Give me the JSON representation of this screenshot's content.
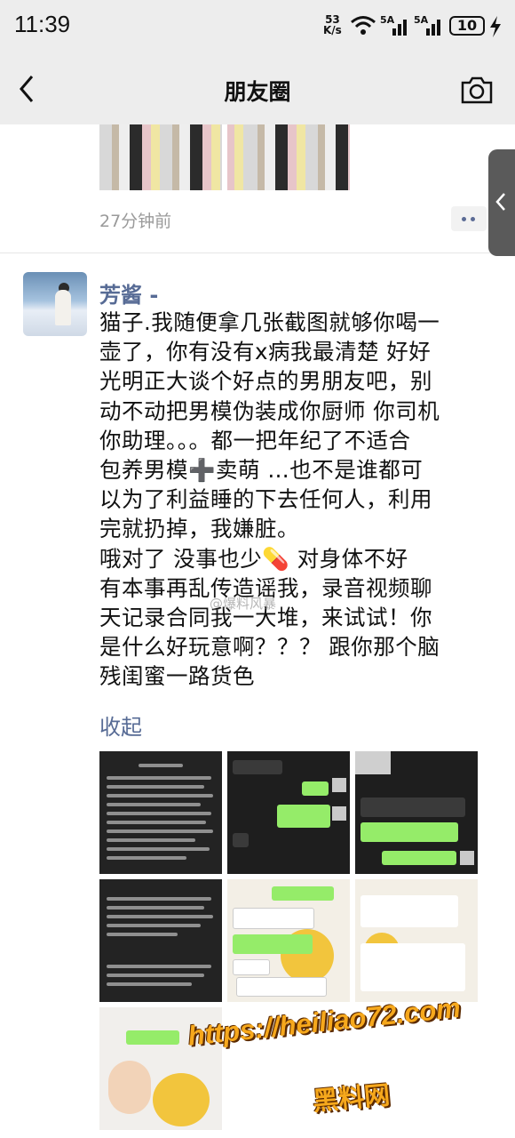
{
  "status_bar": {
    "time": "11:39",
    "net_speed_value": "53",
    "net_speed_unit": "K/s",
    "signal_1_label": "5A",
    "signal_2_label": "5A",
    "battery": "10"
  },
  "nav": {
    "title": "朋友圈",
    "back_icon": "chevron-left-icon",
    "camera_icon": "camera-icon"
  },
  "prev_post": {
    "timestamp": "27分钟前"
  },
  "post": {
    "username": "芳酱 -",
    "text": "猫子.我随便拿几张截图就够你喝一\n壶了，你有没有x病我最清楚 好好\n光明正大谈个好点的男朋友吧，别\n动不动把男模伪装成你厨师 你司机\n你助理。。。都一把年纪了不适合\n包养男模➕卖萌 …也不是谁都可\n以为了利益睡的下去任何人，利用\n完就扔掉，我嫌脏。\n哦对了 没事也少💊 对身体不好\n有本事再乱传造谣我，录音视频聊\n天记录合同我一大堆，来试试！你\n是什么好玩意啊？？？ 跟你那个脑\n残闺蜜一路货色",
    "collapse_label": "收起",
    "watermark_overlay": "@爆料风暴"
  },
  "overlay": {
    "url": "https://heiliao72.com",
    "site_name": "黑料网"
  },
  "colors": {
    "link": "#576b95",
    "header_bg": "#ededed",
    "promo": "#f6a81c"
  }
}
